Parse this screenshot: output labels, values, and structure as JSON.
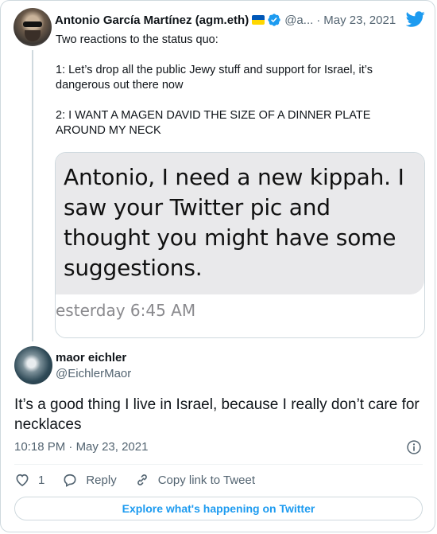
{
  "parent_tweet": {
    "author_name": "Antonio García Martínez (agm.eth)",
    "handle": "@a...",
    "separator": "·",
    "date": "May 23, 2021",
    "paragraphs": [
      "Two reactions to the status quo:",
      "1: Let’s drop all the public Jewy stuff and support for Israel, it’s dangerous out there now",
      "2: I WANT A MAGEN DAVID THE SIZE OF A DINNER PLATE AROUND MY NECK"
    ],
    "media": {
      "message_text": "Antonio, I need a new kippah. I saw your Twitter pic and thought you might have some suggestions.",
      "timestamp": "esterday 6:45 AM"
    }
  },
  "reply_tweet": {
    "author_name": "maor eichler",
    "handle": "@EichlerMaor",
    "text": "It’s a good thing I live in Israel, because I really don’t care for necklaces",
    "time": "10:18 PM",
    "separator": "·",
    "date": "May 23, 2021"
  },
  "actions": {
    "like_count": "1",
    "reply_label": "Reply",
    "copy_link_label": "Copy link to Tweet"
  },
  "explore_button": "Explore what's happening on Twitter",
  "icons": {
    "flag": "ukraine-flag-icon",
    "verified": "verified-badge-icon",
    "brand": "twitter-bird-icon",
    "info": "info-icon",
    "like": "heart-icon",
    "reply": "reply-bubble-icon",
    "copy_link": "link-icon"
  },
  "colors": {
    "accent": "#1d9bf0",
    "text": "#0f1419",
    "secondary": "#536471",
    "border": "#cfd9de"
  }
}
